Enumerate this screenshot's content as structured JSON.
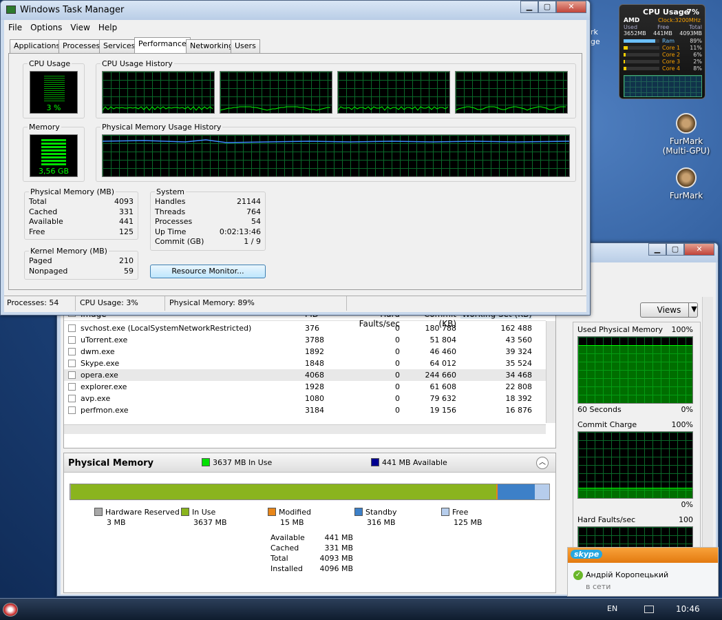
{
  "gadget": {
    "title": "CPU Usage",
    "percent": "7%",
    "brand": "AMD",
    "clock": "Clock:3200MHz",
    "headers": [
      "Used",
      "Free",
      "Total"
    ],
    "values": [
      "3652MB",
      "441MB",
      "4093MB"
    ],
    "rows": [
      {
        "name": "Ram",
        "value": "89%",
        "level": 0.89
      },
      {
        "name": "Core 1",
        "value": "11%",
        "level": 0.11
      },
      {
        "name": "Core 2",
        "value": "6%",
        "level": 0.06
      },
      {
        "name": "Core 3",
        "value": "2%",
        "level": 0.02
      },
      {
        "name": "Core 4",
        "value": "8%",
        "level": 0.08
      }
    ]
  },
  "desktop": {
    "icon1": "FurMark\n(Multi-GPU)",
    "icon2": "FurMark",
    "partial_text": [
      "rk",
      "ge"
    ]
  },
  "tm": {
    "title": "Windows Task Manager",
    "menu": [
      "File",
      "Options",
      "View",
      "Help"
    ],
    "tabs": [
      "Applications",
      "Processes",
      "Services",
      "Performance",
      "Networking",
      "Users"
    ],
    "cpu_usage_label": "CPU Usage",
    "cpu_usage_value": "3 %",
    "cpu_usage_level": 0.03,
    "cpu_history_label": "CPU Usage History",
    "memory_label": "Memory",
    "memory_value": "3,56 GB",
    "memory_level": 0.89,
    "pmh_label": "Physical Memory Usage History",
    "physical": {
      "title": "Physical Memory (MB)",
      "rows": [
        [
          "Total",
          "4093"
        ],
        [
          "Cached",
          "331"
        ],
        [
          "Available",
          "441"
        ],
        [
          "Free",
          "125"
        ]
      ]
    },
    "kernel": {
      "title": "Kernel Memory (MB)",
      "rows": [
        [
          "Paged",
          "210"
        ],
        [
          "Nonpaged",
          "59"
        ]
      ]
    },
    "system": {
      "title": "System",
      "rows": [
        [
          "Handles",
          "21144"
        ],
        [
          "Threads",
          "764"
        ],
        [
          "Processes",
          "54"
        ],
        [
          "Up Time",
          "0:02:13:46"
        ],
        [
          "Commit (GB)",
          "1 / 9"
        ]
      ]
    },
    "resource_monitor": "Resource Monitor...",
    "status": [
      "Processes: 54",
      "CPU Usage: 3%",
      "Physical Memory: 89%"
    ]
  },
  "rm": {
    "views": "Views",
    "columns": [
      "Image",
      "PID",
      "Hard Faults/sec",
      "Commit (KB)",
      "Working Set (KB)"
    ],
    "rows": [
      [
        "svchost.exe (LocalSystemNetworkRestricted)",
        "376",
        "0",
        "180 788",
        "162 488"
      ],
      [
        "uTorrent.exe",
        "3788",
        "0",
        "51 804",
        "43 560"
      ],
      [
        "dwm.exe",
        "1892",
        "0",
        "46 460",
        "39 324"
      ],
      [
        "Skype.exe",
        "1848",
        "0",
        "64 012",
        "35 524"
      ],
      [
        "opera.exe",
        "4068",
        "0",
        "244 660",
        "34 468"
      ],
      [
        "explorer.exe",
        "1928",
        "0",
        "61 608",
        "22 808"
      ],
      [
        "avp.exe",
        "1080",
        "0",
        "79 632",
        "18 392"
      ],
      [
        "perfmon.exe",
        "3184",
        "0",
        "19 156",
        "16 876"
      ]
    ],
    "pm_title": "Physical Memory",
    "in_use": "3637 MB In Use",
    "available": "441 MB Available",
    "bar": {
      "reserved": 3,
      "in_use": 3637,
      "modified": 15,
      "standby": 316,
      "free": 125
    },
    "legend": [
      {
        "name": "Hardware Reserved",
        "value": "3 MB",
        "color": "#a8a8a8"
      },
      {
        "name": "In Use",
        "value": "3637 MB",
        "color": "#8ab41e"
      },
      {
        "name": "Modified",
        "value": "15 MB",
        "color": "#e8861a"
      },
      {
        "name": "Standby",
        "value": "316 MB",
        "color": "#3d80c8"
      },
      {
        "name": "Free",
        "value": "125 MB",
        "color": "#b6cdec"
      }
    ],
    "summary": [
      [
        "Available",
        "441 MB"
      ],
      [
        "Cached",
        "331 MB"
      ],
      [
        "Total",
        "4093 MB"
      ],
      [
        "Installed",
        "4096 MB"
      ]
    ],
    "graphs": [
      {
        "title": "Used Physical Memory",
        "max": "100%",
        "footer_left": "60 Seconds",
        "footer_right": "0%"
      },
      {
        "title": "Commit Charge",
        "max": "100%",
        "footer_left": "",
        "footer_right": "0%"
      },
      {
        "title": "Hard Faults/sec",
        "max": "100"
      }
    ]
  },
  "skype": {
    "brand": "skype",
    "name": "Андрій Коропецький",
    "status": "в сети"
  },
  "taskbar": {
    "lang": "EN",
    "time": "10:46"
  },
  "colors": {
    "graph_green": "#00e000",
    "grid": "#0a6a2a",
    "bar_green": "#8ab41e",
    "bar_blue": "#3d80c8"
  }
}
